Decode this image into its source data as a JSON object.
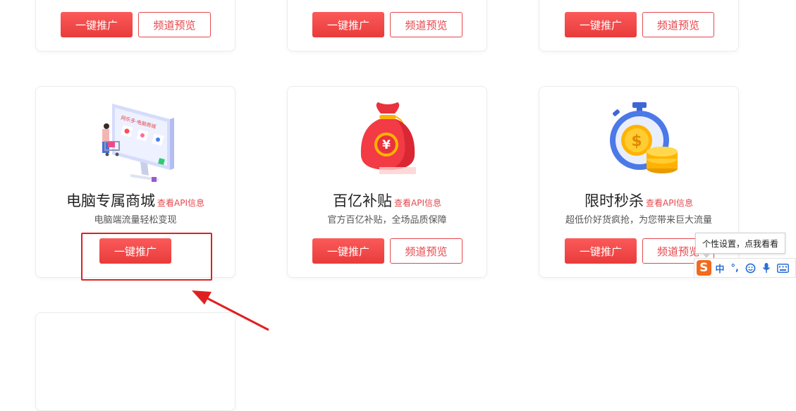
{
  "top_row": [
    {
      "promote_label": "一键推广",
      "preview_label": "频道预览"
    },
    {
      "promote_label": "一键推广",
      "preview_label": "频道预览"
    },
    {
      "promote_label": "一键推广",
      "preview_label": "频道预览"
    }
  ],
  "cards": [
    {
      "title": "电脑专属商城",
      "api_link": "查看API信息",
      "subtitle": "电脑端流量轻松变现",
      "promote_label": "一键推广",
      "illustration": "computer-mall-illustration",
      "screen_text": "网乐多·电脑商城"
    },
    {
      "title": "百亿补贴",
      "api_link": "查看API信息",
      "subtitle": "官方百亿补贴，全场品质保障",
      "promote_label": "一键推广",
      "preview_label": "频道预览",
      "illustration": "money-bag-illustration",
      "bag_symbol": "¥"
    },
    {
      "title": "限时秒杀",
      "api_link": "查看API信息",
      "subtitle": "超低价好货疯抢，为您带来巨大流量",
      "promote_label": "一键推广",
      "preview_label": "频道预览",
      "illustration": "stopwatch-coins-illustration",
      "coin_symbol": "$"
    }
  ],
  "ime": {
    "tooltip": "个性设置，点我看看",
    "logo": "S",
    "lang": "中",
    "punct": "°,",
    "icons": [
      "smiley-icon",
      "microphone-icon",
      "keyboard-icon"
    ]
  },
  "colors": {
    "accent": "#e5484d",
    "annotation": "#e02020",
    "ime_brand": "#f26a1b"
  }
}
